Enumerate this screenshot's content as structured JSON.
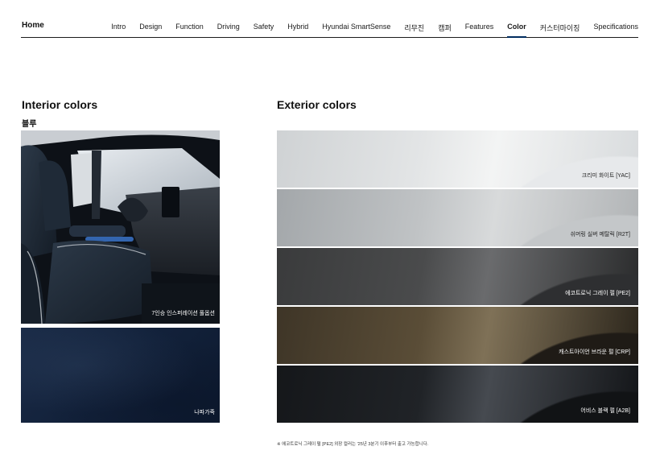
{
  "nav": {
    "home": "Home",
    "items": [
      {
        "label": "Intro",
        "active": false
      },
      {
        "label": "Design",
        "active": false
      },
      {
        "label": "Function",
        "active": false
      },
      {
        "label": "Driving",
        "active": false
      },
      {
        "label": "Safety",
        "active": false
      },
      {
        "label": "Hybrid",
        "active": false
      },
      {
        "label": "Hyundai SmartSense",
        "active": false
      },
      {
        "label": "리무진",
        "active": false
      },
      {
        "label": "캠퍼",
        "active": false
      },
      {
        "label": "Features",
        "active": false
      },
      {
        "label": "Color",
        "active": true
      },
      {
        "label": "커스터마이징",
        "active": false
      },
      {
        "label": "Specifications",
        "active": false
      }
    ]
  },
  "interior": {
    "heading": "Interior colors",
    "color_name": "블루",
    "images": [
      {
        "caption": "7인승 인스퍼레이션 풀옵션"
      },
      {
        "caption": "나파가죽"
      }
    ]
  },
  "exterior": {
    "heading": "Exterior colors",
    "swatches": [
      {
        "caption": "크리미 화이트 [YAC]",
        "text_color": "#222222"
      },
      {
        "caption": "쉬머링 실버 메탈릭 [R2T]",
        "text_color": "#222222"
      },
      {
        "caption": "에코트로닉 그레이 펄 [PE2]",
        "text_color": "#ffffff"
      },
      {
        "caption": "캐스트아이언 브라운 펄 [CRP]",
        "text_color": "#ffffff"
      },
      {
        "caption": "어비스 블랙 펄 [A2B]",
        "text_color": "#ffffff"
      }
    ],
    "footnote": "※ 에코트로닉 그레이 펄 [PE2] 외장 컬러는 '25년 3분기 이후부터 출고 가능합니다."
  },
  "colors": {
    "accent": "#002c5f"
  }
}
